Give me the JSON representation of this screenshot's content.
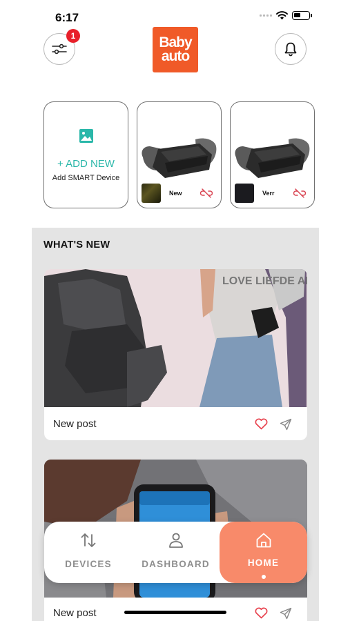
{
  "status_bar": {
    "time": "6:17"
  },
  "header": {
    "filter_badge": "1",
    "logo_line1": "Baby",
    "logo_line2": "auto",
    "icons": [
      "filter-sliders-icon",
      "bell-icon"
    ]
  },
  "devices": {
    "add_card": {
      "title": "+ ADD NEW",
      "subtitle": "Add SMART Device"
    },
    "items": [
      {
        "name": "New",
        "status_icon": "link-off-icon"
      },
      {
        "name": "Verr",
        "status_icon": "link-off-icon"
      }
    ]
  },
  "news": {
    "heading": "WHAT'S NEW",
    "posts": [
      {
        "caption": "New post",
        "image_text": "LOVE LIEFDE AMOR"
      },
      {
        "caption": "New post"
      }
    ]
  },
  "bottom_nav": {
    "items": [
      {
        "label": "DEVICES",
        "icon": "arrows-up-down-icon",
        "active": false
      },
      {
        "label": "DASHBOARD",
        "icon": "user-icon",
        "active": false
      },
      {
        "label": "HOME",
        "icon": "home-icon",
        "active": true
      }
    ]
  },
  "colors": {
    "brand": "#f05a28",
    "accent_teal": "#2ab7a9",
    "nav_active": "#f88a6a",
    "badge": "#e8202a",
    "heart": "#e8434f"
  }
}
